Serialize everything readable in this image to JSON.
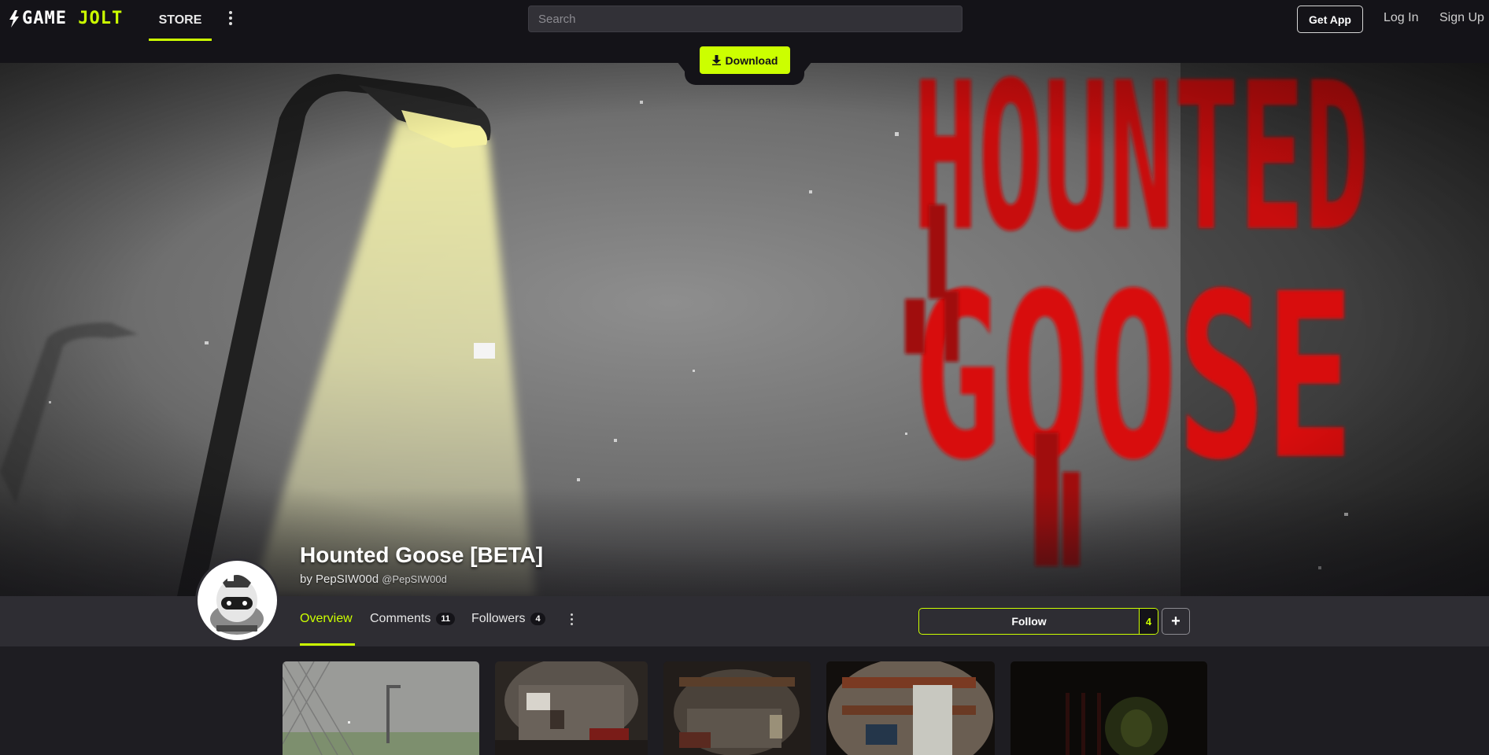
{
  "nav": {
    "logo_text_a": "GAME",
    "logo_text_b": "JOLT",
    "store_label": "STORE",
    "search_placeholder": "Search",
    "get_app_label": "Get App",
    "login_label": "Log In",
    "signup_label": "Sign Up"
  },
  "download": {
    "label": "Download",
    "icon": "download-arrow-icon"
  },
  "banner": {
    "art_title": "HOUNTED GOOSE",
    "art_color": "#d40d0d"
  },
  "game": {
    "title": "Hounted Goose [BETA]",
    "by_prefix": "by",
    "author": "PepSIW00d",
    "handle": "@PepSIW00d"
  },
  "tabs": [
    {
      "label": "Overview",
      "active": true
    },
    {
      "label": "Comments",
      "count": "11"
    },
    {
      "label": "Followers",
      "count": "4"
    }
  ],
  "follow": {
    "label": "Follow",
    "count": "4",
    "plus": "+"
  },
  "colors": {
    "accent": "#ccff00",
    "nav_bg": "#141318",
    "subnav_bg": "#2e2d33",
    "page_bg": "#1e1d22"
  },
  "thumbnails": [
    {
      "name": "foggy-fence-scene"
    },
    {
      "name": "basement-room-scene"
    },
    {
      "name": "dark-cellar-scene"
    },
    {
      "name": "fisheye-room-scene"
    },
    {
      "name": "dark-green-corridor-scene"
    }
  ]
}
